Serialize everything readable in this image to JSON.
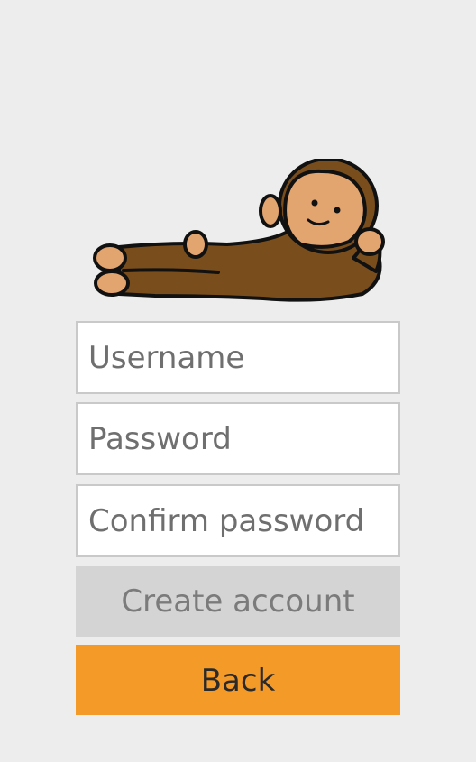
{
  "mascot": {
    "icon": "reclining-monkey-icon",
    "fur_color": "#7a4e1c",
    "skin_color": "#e3a570"
  },
  "form": {
    "username_placeholder": "Username",
    "password_placeholder": "Password",
    "confirm_password_placeholder": "Confirm password",
    "create_account_label": "Create account",
    "back_label": "Back"
  },
  "colors": {
    "background": "#ededed",
    "create_button_bg": "#d4d4d4",
    "back_button_bg": "#f39a29"
  }
}
